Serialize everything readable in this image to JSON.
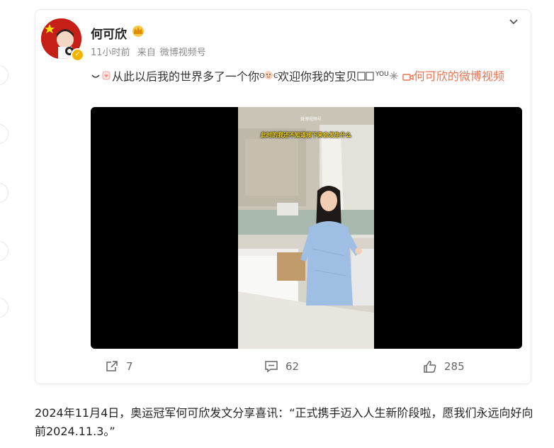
{
  "post": {
    "author": "何可欣",
    "time": "11小时前",
    "source_prefix": "来自",
    "source": "微博视频号",
    "text_before": "从此以后我的世界多了一个你",
    "text_middle": "欢迎你我的宝贝",
    "text_tail": "YOU",
    "link_text": "何可欣的微博视频",
    "video_caption": "此时的我还不知道接下来会发生什么",
    "video_watermark": "微博视频号"
  },
  "actions": {
    "repost_count": "7",
    "comment_count": "62",
    "like_count": "285"
  },
  "caption": "2024年11月4日，奥运冠军何可欣发文分享喜讯：“正式携手迈入人生新阶段啦，愿我们永远向好向前2024.11.3。”",
  "colors": {
    "link": "#eb7350",
    "verified_badge": "#f5b400",
    "avatar_bg": "#c61f18"
  },
  "icons": [
    "verified-icon",
    "crown-icon",
    "chevron-down-icon",
    "repost-icon",
    "comment-icon",
    "like-icon",
    "video-camera-icon"
  ]
}
